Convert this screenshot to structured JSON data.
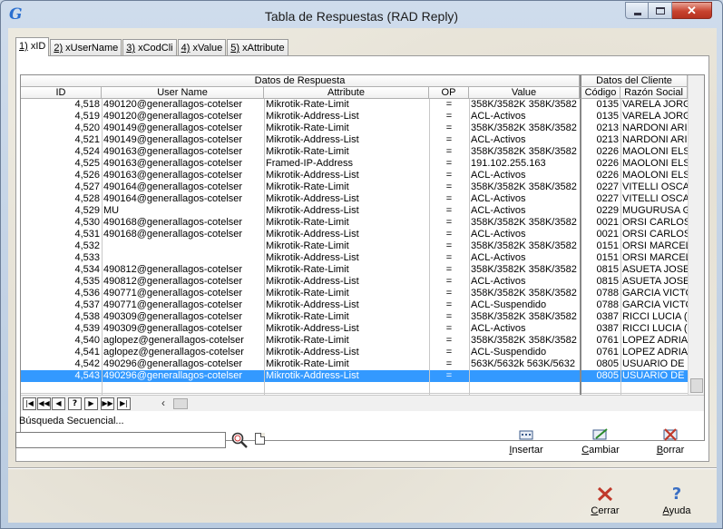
{
  "window": {
    "title": "Tabla de Respuestas (RAD Reply)",
    "app_icon": "G"
  },
  "tabs": [
    {
      "key": "1)",
      "label": " xID"
    },
    {
      "key": "2)",
      "label": " xUserName"
    },
    {
      "key": "3)",
      "label": " xCodCli"
    },
    {
      "key": "4)",
      "label": " xValue"
    },
    {
      "key": "5)",
      "label": " xAttribute"
    }
  ],
  "grid": {
    "group_headers": {
      "respuesta": "Datos de Respuesta",
      "cliente": "Datos del Cliente"
    },
    "columns": {
      "id": "ID",
      "user": "User Name",
      "attr": "Attribute",
      "op": "OP",
      "value": "Value",
      "codigo": "Código",
      "razon": "Razón Social"
    },
    "rows": [
      {
        "id": "4,518",
        "user": "490120@generallagos-cotelser",
        "attr": "Mikrotik-Rate-Limit",
        "op": "=",
        "value": "358K/3582K 358K/3582",
        "codigo": "0135",
        "razon": "VARELA JORGE"
      },
      {
        "id": "4,519",
        "user": "490120@generallagos-cotelser",
        "attr": "Mikrotik-Address-List",
        "op": "=",
        "value": "ACL-Activos",
        "codigo": "0135",
        "razon": "VARELA JORGE"
      },
      {
        "id": "4,520",
        "user": "490149@generallagos-cotelser",
        "attr": "Mikrotik-Rate-Limit",
        "op": "=",
        "value": "358K/3582K 358K/3582",
        "codigo": "0213",
        "razon": "NARDONI ARIEL"
      },
      {
        "id": "4,521",
        "user": "490149@generallagos-cotelser",
        "attr": "Mikrotik-Address-List",
        "op": "=",
        "value": "ACL-Activos",
        "codigo": "0213",
        "razon": "NARDONI ARIEL"
      },
      {
        "id": "4,524",
        "user": "490163@generallagos-cotelser",
        "attr": "Mikrotik-Rate-Limit",
        "op": "=",
        "value": "358K/3582K 358K/3582",
        "codigo": "0226",
        "razon": "MAOLONI ELSA"
      },
      {
        "id": "4,525",
        "user": "490163@generallagos-cotelser",
        "attr": "Framed-IP-Address",
        "op": "=",
        "value": "191.102.255.163",
        "codigo": "0226",
        "razon": "MAOLONI ELSA"
      },
      {
        "id": "4,526",
        "user": "490163@generallagos-cotelser",
        "attr": "Mikrotik-Address-List",
        "op": "=",
        "value": "ACL-Activos",
        "codigo": "0226",
        "razon": "MAOLONI ELSA"
      },
      {
        "id": "4,527",
        "user": "490164@generallagos-cotelser",
        "attr": "Mikrotik-Rate-Limit",
        "op": "=",
        "value": "358K/3582K 358K/3582",
        "codigo": "0227",
        "razon": "VITELLI OSCAR"
      },
      {
        "id": "4,528",
        "user": "490164@generallagos-cotelser",
        "attr": "Mikrotik-Address-List",
        "op": "=",
        "value": "ACL-Activos",
        "codigo": "0227",
        "razon": "VITELLI OSCAR"
      },
      {
        "id": "4,529",
        "user": "MU",
        "attr": "Mikrotik-Address-List",
        "op": "=",
        "value": "ACL-Activos",
        "codigo": "0229",
        "razon": "MUGURUSA GUSTAVO"
      },
      {
        "id": "4,530",
        "user": "490168@generallagos-cotelser",
        "attr": "Mikrotik-Rate-Limit",
        "op": "=",
        "value": "358K/3582K 358K/3582",
        "codigo": "0021",
        "razon": "ORSI CARLOS"
      },
      {
        "id": "4,531",
        "user": "490168@generallagos-cotelser",
        "attr": "Mikrotik-Address-List",
        "op": "=",
        "value": "ACL-Activos",
        "codigo": "0021",
        "razon": "ORSI CARLOS"
      },
      {
        "id": "4,532",
        "user": "",
        "attr": "Mikrotik-Rate-Limit",
        "op": "=",
        "value": "358K/3582K 358K/3582",
        "codigo": "0151",
        "razon": "ORSI MARCELO"
      },
      {
        "id": "4,533",
        "user": "",
        "attr": "Mikrotik-Address-List",
        "op": "=",
        "value": "ACL-Activos",
        "codigo": "0151",
        "razon": "ORSI MARCELO"
      },
      {
        "id": "4,534",
        "user": "490812@generallagos-cotelser",
        "attr": "Mikrotik-Rate-Limit",
        "op": "=",
        "value": "358K/3582K 358K/3582",
        "codigo": "0815",
        "razon": "ASUETA JOSE"
      },
      {
        "id": "4,535",
        "user": "490812@generallagos-cotelser",
        "attr": "Mikrotik-Address-List",
        "op": "=",
        "value": "ACL-Activos",
        "codigo": "0815",
        "razon": "ASUETA JOSE"
      },
      {
        "id": "4,536",
        "user": "490771@generallagos-cotelser",
        "attr": "Mikrotik-Rate-Limit",
        "op": "=",
        "value": "358K/3582K 358K/3582",
        "codigo": "0788",
        "razon": "GARCIA VICTOR"
      },
      {
        "id": "4,537",
        "user": "490771@generallagos-cotelser",
        "attr": "Mikrotik-Address-List",
        "op": "=",
        "value": "ACL-Suspendido",
        "codigo": "0788",
        "razon": "GARCIA VICTOR"
      },
      {
        "id": "4,538",
        "user": "490309@generallagos-cotelser",
        "attr": "Mikrotik-Rate-Limit",
        "op": "=",
        "value": "358K/3582K 358K/3582",
        "codigo": "0387",
        "razon": "RICCI LUCIA (R)"
      },
      {
        "id": "4,539",
        "user": "490309@generallagos-cotelser",
        "attr": "Mikrotik-Address-List",
        "op": "=",
        "value": "ACL-Activos",
        "codigo": "0387",
        "razon": "RICCI LUCIA (R)"
      },
      {
        "id": "4,540",
        "user": "aglopez@generallagos-cotelser",
        "attr": "Mikrotik-Rate-Limit",
        "op": "=",
        "value": "358K/3582K 358K/3582",
        "codigo": "0761",
        "razon": "LOPEZ ADRIANA"
      },
      {
        "id": "4,541",
        "user": "aglopez@generallagos-cotelser",
        "attr": "Mikrotik-Address-List",
        "op": "=",
        "value": "ACL-Suspendido",
        "codigo": "0761",
        "razon": "LOPEZ ADRIANA"
      },
      {
        "id": "4,542",
        "user": "490296@generallagos-cotelser",
        "attr": "Mikrotik-Rate-Limit",
        "op": "=",
        "value": "563K/5632k 563K/5632",
        "codigo": "0805",
        "razon": "USUARIO DE PRUEBA"
      },
      {
        "id": "4,543",
        "user": "490296@generallagos-cotelser",
        "attr": "Mikrotik-Address-List",
        "op": "=",
        "value": "",
        "codigo": "0805",
        "razon": "USUARIO DE PRUEBA"
      }
    ],
    "selected_index": 23,
    "nav_buttons": [
      "|◀",
      "◀◀",
      "◀",
      "?",
      "▶",
      "▶▶",
      "▶|"
    ]
  },
  "search": {
    "label": "Búsqueda Secuencial...",
    "value": ""
  },
  "actions": {
    "insertar": {
      "mnemonic": "I",
      "rest": "nsertar",
      "icon": "insert-icon"
    },
    "cambiar": {
      "mnemonic": "C",
      "rest": "ambiar",
      "icon": "edit-icon"
    },
    "borrar": {
      "mnemonic": "B",
      "rest": "orrar",
      "icon": "delete-icon"
    },
    "cerrar": {
      "mnemonic": "C",
      "rest": "errar",
      "icon": "close-icon"
    },
    "ayuda": {
      "mnemonic": "A",
      "rest": "yuda",
      "icon": "help-icon"
    }
  },
  "colors": {
    "selection": "#3399ff",
    "close_red": "#c8432f"
  }
}
